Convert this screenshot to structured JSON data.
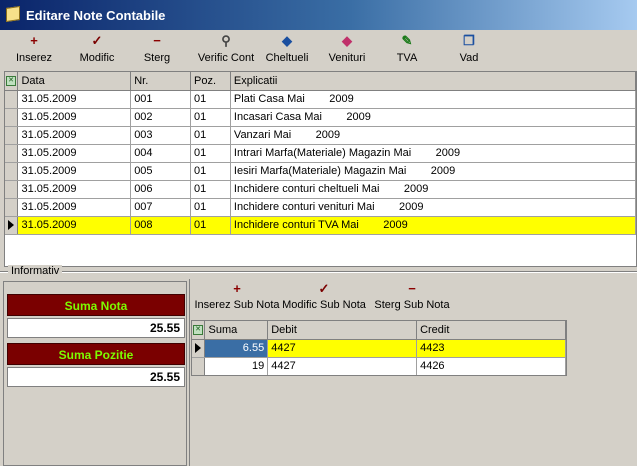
{
  "window": {
    "title": "Editare Note Contabile"
  },
  "toolbar": {
    "buttons": [
      {
        "label": "Inserez",
        "glyph": "+",
        "color": "#8b0000"
      },
      {
        "label": "Modific",
        "glyph": "✓",
        "color": "#7a0000"
      },
      {
        "label": "Sterg",
        "glyph": "−",
        "color": "#8b0000"
      },
      {
        "label": "Verific Cont",
        "glyph": "⚲",
        "color": "#444444"
      },
      {
        "label": "Cheltueli",
        "glyph": "◆",
        "color": "#1a4fa0"
      },
      {
        "label": "Venituri",
        "glyph": "◆",
        "color": "#c0306a"
      },
      {
        "label": "TVA",
        "glyph": "✎",
        "color": "#1a7a1a"
      },
      {
        "label": "Vad",
        "glyph": "❐",
        "color": "#1a4fa0"
      }
    ]
  },
  "main_grid": {
    "columns": [
      "Data",
      "Nr.",
      "Poz.",
      "Explicatii"
    ],
    "rows": [
      [
        "31.05.2009",
        "001",
        "01",
        "Plati Casa Mai        2009"
      ],
      [
        "31.05.2009",
        "002",
        "01",
        "Incasari Casa Mai        2009"
      ],
      [
        "31.05.2009",
        "003",
        "01",
        "Vanzari Mai        2009"
      ],
      [
        "31.05.2009",
        "004",
        "01",
        "Intrari Marfa(Materiale) Magazin Mai        2009"
      ],
      [
        "31.05.2009",
        "005",
        "01",
        "Iesiri Marfa(Materiale) Magazin Mai        2009"
      ],
      [
        "31.05.2009",
        "006",
        "01",
        "Inchidere conturi cheltueli Mai        2009"
      ],
      [
        "31.05.2009",
        "007",
        "01",
        "Inchidere conturi venituri Mai        2009"
      ],
      [
        "31.05.2009",
        "008",
        "01",
        "Inchidere conturi TVA Mai        2009"
      ]
    ],
    "selected_row": 7
  },
  "info_panel": {
    "legend": "Informativ",
    "suma_nota_label": "Suma Nota",
    "suma_nota_value": "25.55",
    "suma_pozitie_label": "Suma Pozitie",
    "suma_pozitie_value": "25.55"
  },
  "sub_toolbar": {
    "buttons": [
      {
        "label": "Inserez Sub Nota",
        "glyph": "+",
        "color": "#8b0000"
      },
      {
        "label": "Modific Sub Nota",
        "glyph": "✓",
        "color": "#7a0000"
      },
      {
        "label": "Sterg Sub Nota",
        "glyph": "−",
        "color": "#8b0000"
      }
    ]
  },
  "sub_grid": {
    "columns": [
      "Suma",
      "Debit",
      "Credit"
    ],
    "rows": [
      [
        "6.55",
        "4427",
        "4423"
      ],
      [
        "19",
        "4427",
        "4426"
      ]
    ],
    "selected_row": 0
  }
}
